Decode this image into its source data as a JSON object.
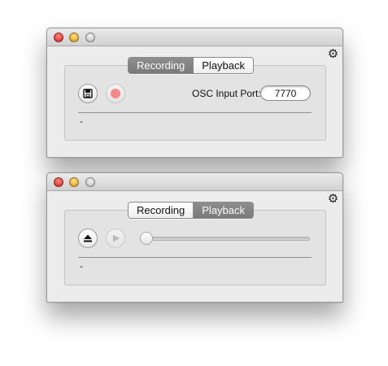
{
  "windows": {
    "recording_window": {
      "tabs": [
        "Recording",
        "Playback"
      ],
      "active_tab": "Recording",
      "osc_label": "OSC Input Port:",
      "osc_port": "7770",
      "status": "-"
    },
    "playback_window": {
      "tabs": [
        "Recording",
        "Playback"
      ],
      "active_tab": "Playback",
      "status": "-",
      "playback_position": 0
    }
  },
  "icons": {
    "gear": "gear-icon",
    "save": "save-icon",
    "record": "record-icon",
    "eject": "eject-icon",
    "play": "play-icon"
  },
  "colors": {
    "record_dot": "#f48a8a",
    "active_tab": "#808080"
  }
}
